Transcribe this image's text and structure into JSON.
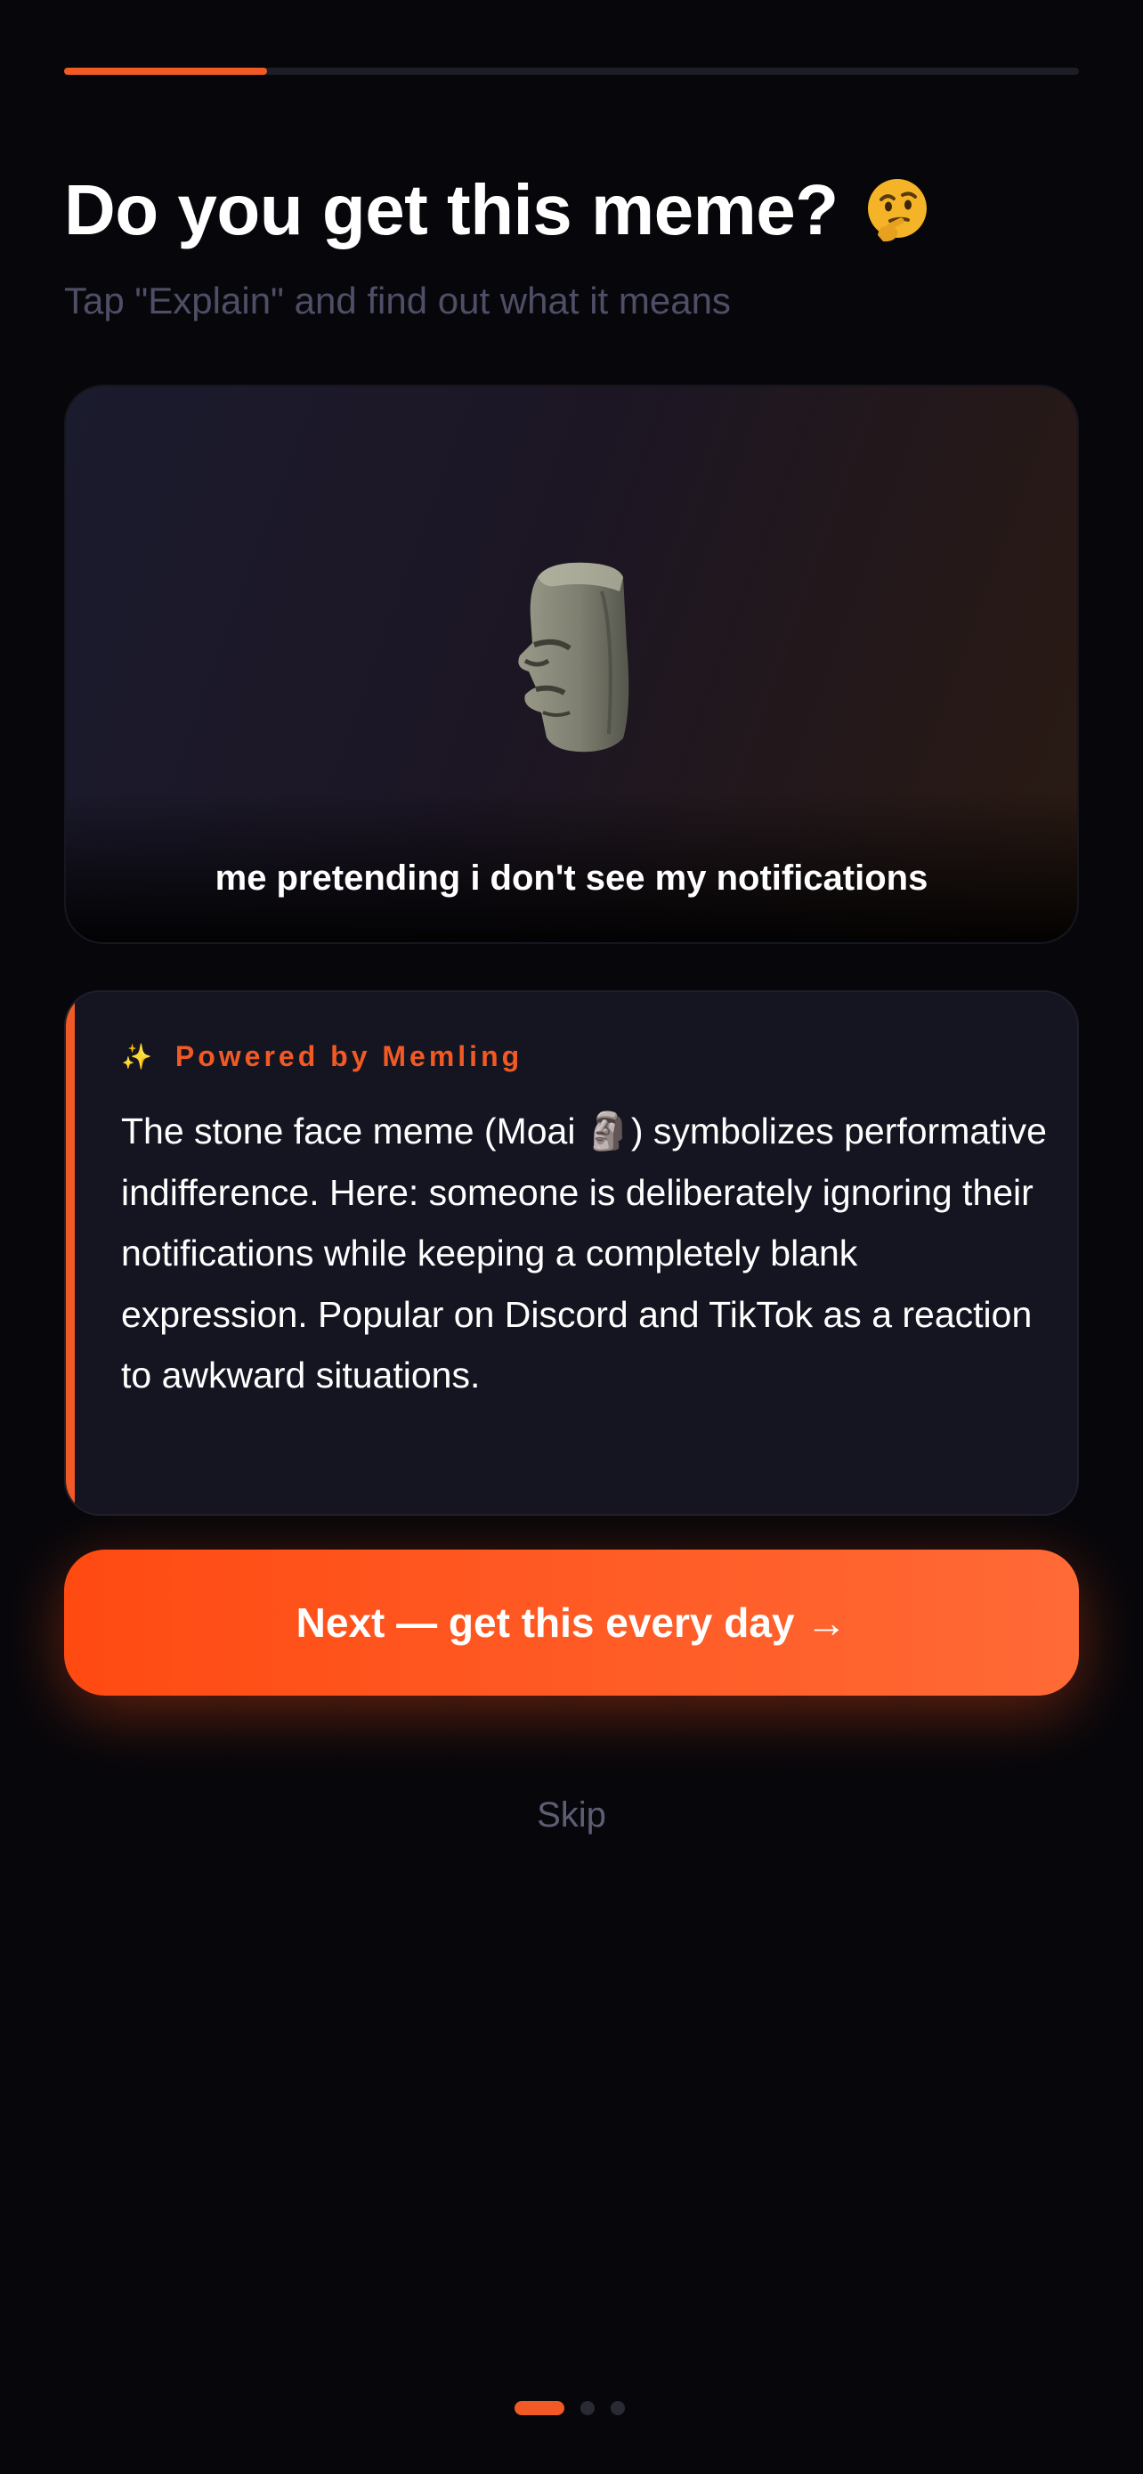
{
  "onboarding": {
    "progress": 0.2,
    "title": "Do you get this meme?",
    "title_emoji": "thinking-face-icon",
    "subtitle": "Tap \"Explain\" and find out what it means"
  },
  "meme": {
    "image": "moai-stone-face",
    "caption": "me pretending i don't see my notifications"
  },
  "explanation": {
    "sparkle": "✨",
    "powered_by": "Powered by Memling",
    "text": "The stone face meme (Moai 🗿) symbolizes performative indifference. Here: someone is deliberately ignoring their notifications while keeping a completely blank expression. Popular on Discord and TikTok as a reaction to awkward situations."
  },
  "actions": {
    "next_label": "Next — get this every day →",
    "skip_label": "Skip"
  },
  "pagination": {
    "count": 3,
    "active_index": 0
  },
  "colors": {
    "accent": "#f15a24",
    "background": "#07070b",
    "card": "#151521"
  }
}
